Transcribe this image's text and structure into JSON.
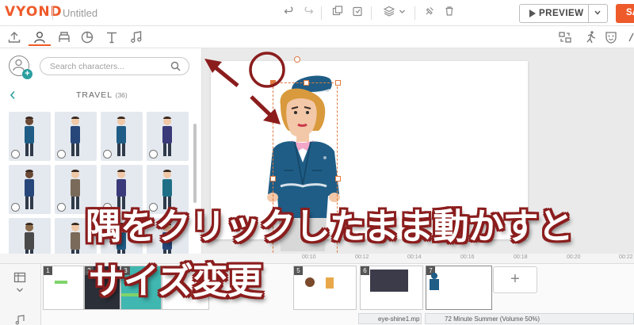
{
  "app": {
    "logo": "VYOND",
    "title": "Untitled"
  },
  "toolbar": {
    "icons": [
      "undo-icon",
      "redo-icon",
      "copy-icon",
      "paste-icon",
      "layers-icon",
      "pin-icon",
      "delete-icon"
    ],
    "preview_label": "PREVIEW",
    "save_label": "SA"
  },
  "tabs": {
    "left": [
      "upload-icon",
      "character-icon",
      "props-icon",
      "charts-icon",
      "text-icon",
      "audio-icon"
    ],
    "active": "character-icon",
    "right": [
      "swap-icon",
      "action-icon",
      "expression-icon",
      "more-icon"
    ]
  },
  "panel": {
    "search_placeholder": "Search characters...",
    "category": "TRAVEL",
    "category_count": "(36)",
    "thumbnails": 12
  },
  "timeline": {
    "ticks": [
      "00:10",
      "00:12",
      "00:14",
      "00:16",
      "00:18",
      "00:20",
      "00:22"
    ],
    "scenes": [
      {
        "num": "1"
      },
      {
        "num": "2"
      },
      {
        "num": "3"
      },
      {
        "num": "4"
      },
      {
        "num": "5"
      },
      {
        "num": "6"
      },
      {
        "num": "7"
      }
    ],
    "add_label": "+",
    "audio": [
      "eye-shine1.mp",
      "72 Minute Summer (Volume 50%)"
    ]
  },
  "overlay": {
    "caption_line1": "隅をクリックしたまま動かすと",
    "caption_line2": "サイズ変更"
  },
  "colors": {
    "brand": "#ef5a2a",
    "accent": "#2a9fa0",
    "annotation": "#8b1d1d",
    "selection": "#e0793f"
  }
}
